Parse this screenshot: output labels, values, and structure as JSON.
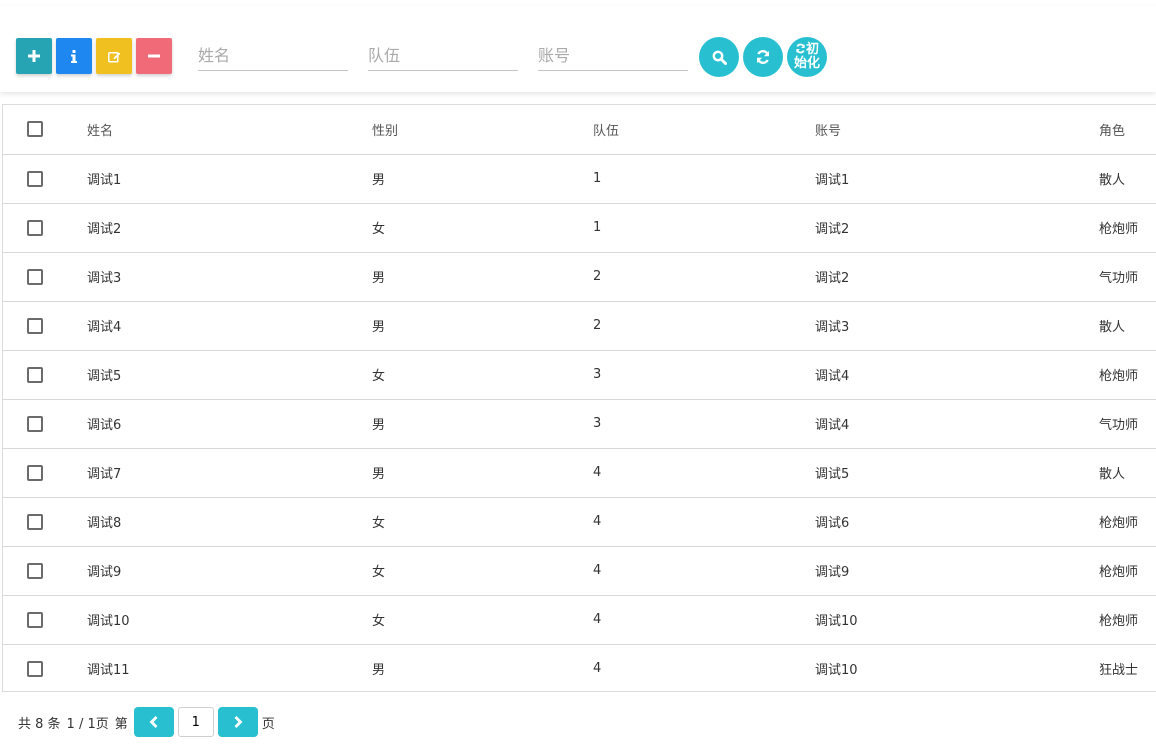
{
  "toolbar": {
    "buttons": [
      {
        "name": "add",
        "icon": "plus-icon",
        "color": "#26a4b4"
      },
      {
        "name": "info",
        "icon": "info-icon",
        "color": "#1e87f0"
      },
      {
        "name": "edit",
        "icon": "edit-icon",
        "color": "#f0c020"
      },
      {
        "name": "delete",
        "icon": "minus-icon",
        "color": "#f06a78"
      }
    ],
    "search_fields": [
      {
        "placeholder": "姓名",
        "value": ""
      },
      {
        "placeholder": "队伍",
        "value": ""
      },
      {
        "placeholder": "账号",
        "value": ""
      }
    ],
    "search_icon": "search-icon",
    "refresh_icon": "refresh-icon",
    "init_label": "初始化",
    "accent": "#28c0d0"
  },
  "table": {
    "headers": [
      "姓名",
      "性别",
      "队伍",
      "账号",
      "角色"
    ],
    "rows": [
      [
        "调试1",
        "男",
        "1",
        "调试1",
        "散人"
      ],
      [
        "调试2",
        "女",
        "1",
        "调试2",
        "枪炮师"
      ],
      [
        "调试3",
        "男",
        "2",
        "调试2",
        "气功师"
      ],
      [
        "调试4",
        "男",
        "2",
        "调试3",
        "散人"
      ],
      [
        "调试5",
        "女",
        "3",
        "调试4",
        "枪炮师"
      ],
      [
        "调试6",
        "男",
        "3",
        "调试4",
        "气功师"
      ],
      [
        "调试7",
        "男",
        "4",
        "调试5",
        "散人"
      ],
      [
        "调试8",
        "女",
        "4",
        "调试6",
        "枪炮师"
      ],
      [
        "调试9",
        "女",
        "4",
        "调试9",
        "枪炮师"
      ],
      [
        "调试10",
        "女",
        "4",
        "调试10",
        "枪炮师"
      ],
      [
        "调试11",
        "男",
        "4",
        "调试10",
        "狂战士"
      ]
    ]
  },
  "pager": {
    "total_text": "共 8 条",
    "pages_text": "1 / 1页",
    "goto_prefix": "第",
    "page_value": "1",
    "goto_suffix": "页"
  }
}
